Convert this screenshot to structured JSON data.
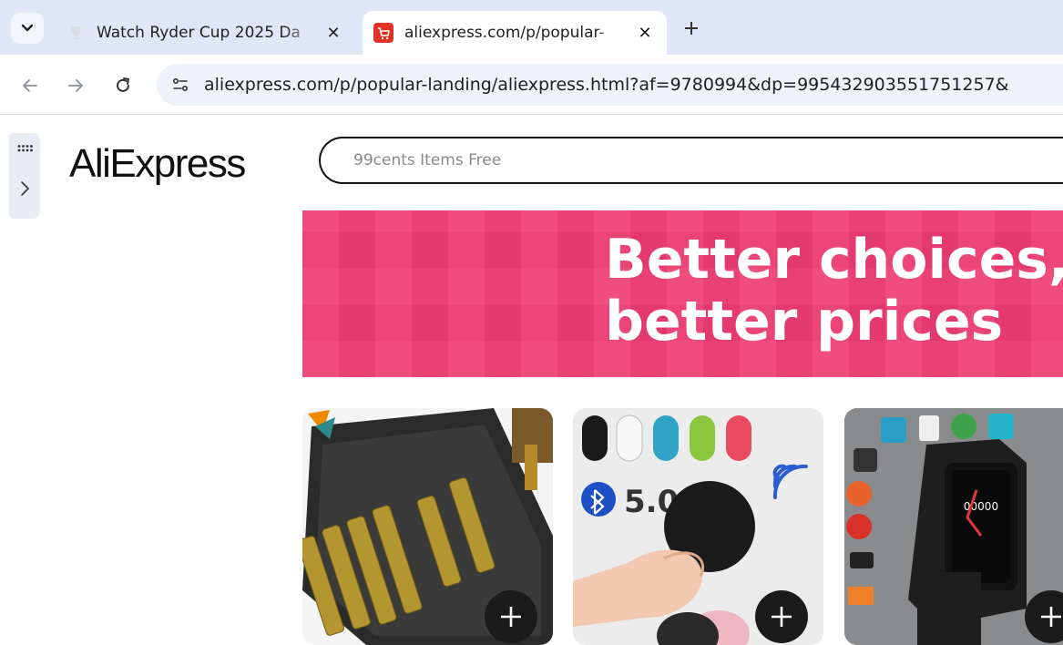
{
  "tabs": [
    {
      "title": "Watch Ryder Cup 2025 Da",
      "favicon": "trophy-icon",
      "active": false
    },
    {
      "title": "aliexpress.com/p/popular-",
      "favicon": "aliexpress-cart-icon",
      "active": true
    }
  ],
  "toolbar": {
    "url": "aliexpress.com/p/popular-landing/aliexpress.html?af=9780994&dp=995432903551751257&"
  },
  "page": {
    "logo": "AliExpress",
    "search_placeholder": "99cents Items Free",
    "banner_line1": "Better choices,",
    "banner_line2": "better prices"
  },
  "products": [
    {
      "image": "screw-extractor-bit-set",
      "add_icon": "plus-icon"
    },
    {
      "image": "bluetooth-tracker-tags",
      "image_text": "5.0",
      "add_icon": "plus-icon"
    },
    {
      "image": "smart-watch",
      "add_icon": "plus-icon"
    }
  ],
  "colors": {
    "tabstrip": "#dfe7f6",
    "banner": "#ef3c73",
    "logo_accent": "#f7a400"
  }
}
